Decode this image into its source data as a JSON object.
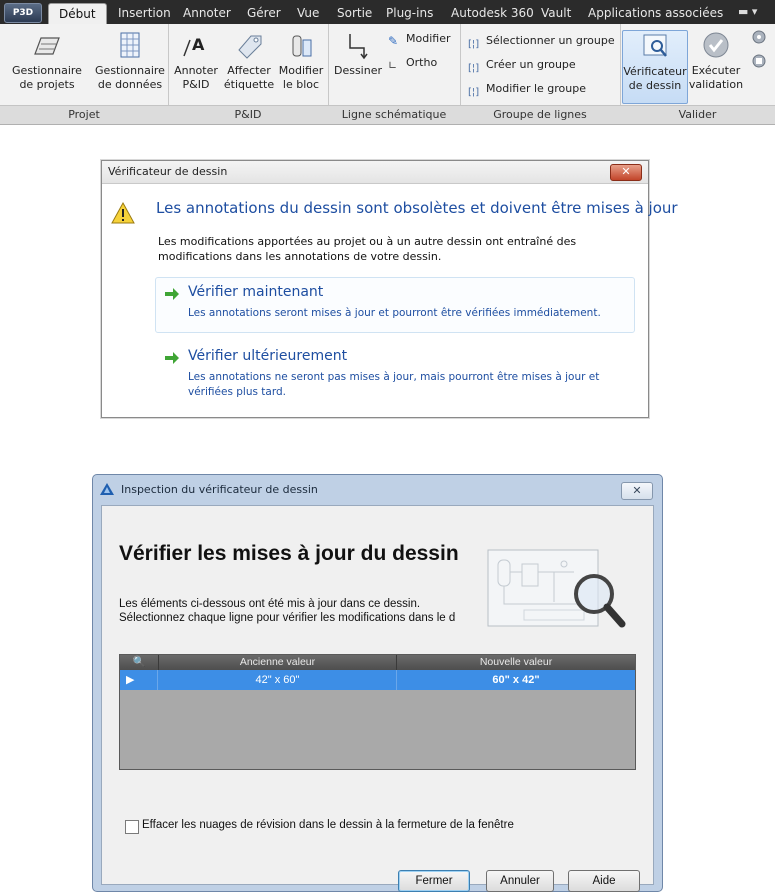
{
  "ribbon": {
    "app_button": "P3D",
    "tabs": [
      "Début",
      "Insertion",
      "Annoter",
      "Gérer",
      "Vue",
      "Sortie",
      "Plug-ins",
      "Autodesk 360",
      "Vault",
      "Applications associées"
    ],
    "panels": {
      "projet": {
        "label": "Projet",
        "project_manager": "Gestionnaire\nde projets",
        "data_manager": "Gestionnaire\nde données"
      },
      "pid": {
        "label": "P&ID",
        "annotate": "Annoter\nP&ID",
        "assign_tag": "Affecter\nétiquette",
        "modify_block": "Modifier\nle bloc"
      },
      "ligne": {
        "label": "Ligne schématique",
        "draw": "Dessiner",
        "modify": "Modifier",
        "ortho": "Ortho"
      },
      "groupe": {
        "label": "Groupe de lignes",
        "select": "Sélectionner un groupe",
        "create": "Créer un groupe",
        "modify": "Modifier le groupe"
      },
      "valider": {
        "label": "Valider",
        "checker": "Vérificateur\nde dessin",
        "run": "Exécuter\nvalidation"
      }
    }
  },
  "dialog1": {
    "title": "Vérificateur de dessin",
    "close": "✕",
    "heading": "Les annotations du dessin sont obsolètes et doivent être mises à jour",
    "body": "Les modifications apportées au projet ou à un autre dessin ont entraîné des modifications dans les annotations de votre dessin.",
    "options": [
      {
        "title": "Vérifier maintenant",
        "desc": "Les annotations seront mises à jour et pourront être vérifiées immédiatement."
      },
      {
        "title": "Vérifier ultérieurement",
        "desc": "Les annotations ne seront pas mises à jour, mais pourront être mises à jour et vérifiées plus tard."
      }
    ]
  },
  "dialog2": {
    "title": "Inspection du vérificateur de dessin",
    "close": "✕",
    "heading": "Vérifier les mises à jour du dessin",
    "desc_line1": "Les éléments ci-dessous ont été mis à jour dans ce dessin.",
    "desc_line2": "Sélectionnez chaque ligne pour vérifier les modifications dans le d",
    "grid": {
      "columns": [
        "Ancienne valeur",
        "Nouvelle valeur"
      ],
      "rows": [
        {
          "old": "42\" x 60\"",
          "new": "60\" x 42\""
        }
      ]
    },
    "checkbox_label": "Effacer les nuages de révision dans le dessin à la fermeture de la fenêtre",
    "checkbox_checked": false,
    "buttons": {
      "close": "Fermer",
      "cancel": "Annuler",
      "help": "Aide"
    }
  }
}
